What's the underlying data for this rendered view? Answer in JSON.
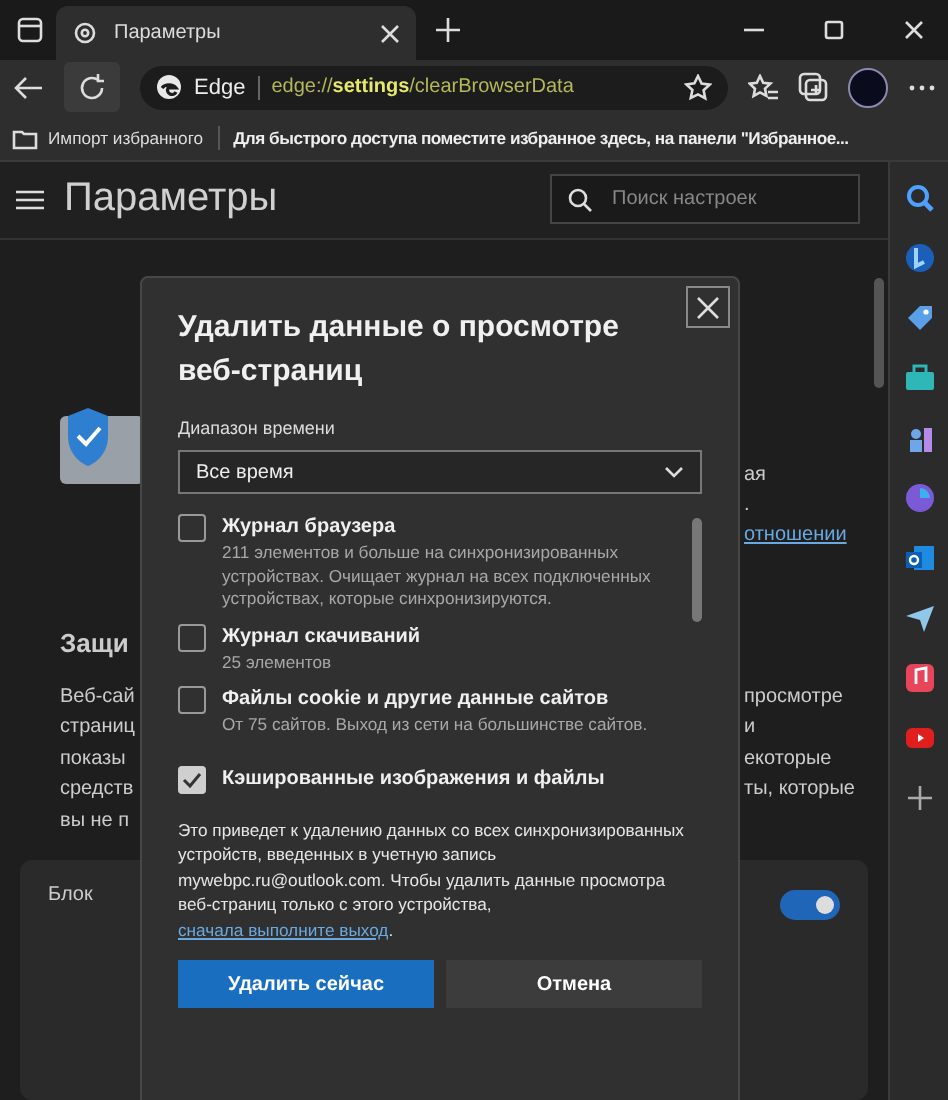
{
  "tab": {
    "title": "Параметры",
    "selected": true
  },
  "address_bar": {
    "site_label": "Edge",
    "url": "edge://**settings**/clearBrowserData"
  },
  "favorites_bar": {
    "import_label": "Импорт избранного",
    "hint": "Для быстрого доступа поместите избранное здесь, на панели \"Избранное..."
  },
  "settings": {
    "title": "Параметры",
    "search": {
      "placeholder": "Поиск настроек"
    }
  },
  "background_page": {
    "side_lines": [
      "ая",
      "."
    ],
    "link": "отношении",
    "heading": "Защи",
    "paragraph_lines": [
      {
        "left": "Веб-сай",
        "right": "просмотре"
      },
      {
        "left": "страниц",
        "right": "и"
      },
      {
        "left": "показы",
        "right": "екоторые"
      },
      {
        "left": "средств",
        "right": "ты, которые"
      },
      {
        "left": "вы не п"
      }
    ],
    "card": {
      "title": "Блок",
      "toggle_on": true
    }
  },
  "dialog": {
    "title": "Удалить данные о просмотре веб-страниц",
    "range_label": "Диапазон времени",
    "range_value": "Все время",
    "items": [
      {
        "label": "Журнал браузера",
        "description": "211 элементов и больше на синхронизированных устройствах. Очищает журнал на всех подключенных устройствах, которые синхронизируются.",
        "checked": false
      },
      {
        "label": "Журнал скачиваний",
        "description": "25 элементов",
        "checked": false
      },
      {
        "label": "Файлы cookie и другие данные сайтов",
        "description": "От 75 сайтов. Выход из сети на большинстве сайтов.",
        "checked": false
      },
      {
        "label": "Кэшированные изображения и файлы",
        "checked": true
      }
    ],
    "notice": "Это приведет к удалению данных со всех синхронизированных устройств, введенных в учетную запись mywebpc.ru@outlook.com. Чтобы удалить данные просмотра веб-страниц только с этого устройства, ",
    "notice_link": "сначала выполните выход",
    "notice_end": ".",
    "buttons": [
      {
        "label": "Удалить сейчас",
        "kind": "primary"
      },
      {
        "label": "Отмена",
        "kind": "secondary"
      }
    ]
  }
}
